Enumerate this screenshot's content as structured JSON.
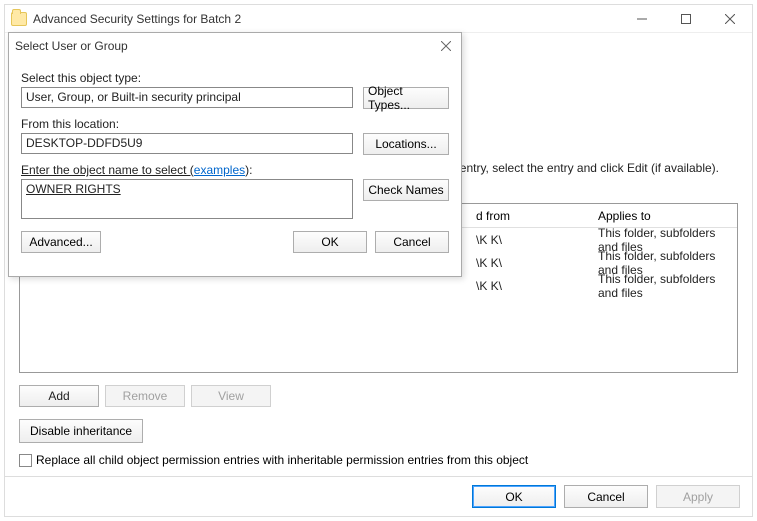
{
  "main": {
    "title": "Advanced Security Settings for Batch 2",
    "info_text": "entry, select the entry and click Edit (if available).",
    "perm_headers": {
      "inherited_from": "d from",
      "applies_to": "Applies to"
    },
    "perm_rows": [
      {
        "inherited_from": "\\K K\\",
        "applies_to": "This folder, subfolders and files"
      },
      {
        "inherited_from": "\\K K\\",
        "applies_to": "This folder, subfolders and files"
      },
      {
        "inherited_from": "\\K K\\",
        "applies_to": "This folder, subfolders and files"
      }
    ],
    "buttons": {
      "add": "Add",
      "remove": "Remove",
      "view": "View"
    },
    "disable_inheritance": "Disable inheritance",
    "replace_label": "Replace all child object permission entries with inheritable permission entries from this object",
    "ok": "OK",
    "cancel": "Cancel",
    "apply": "Apply"
  },
  "dialog": {
    "title": "Select User or Group",
    "object_type_label": "Select this object type:",
    "object_type_value": "User, Group, or Built-in security principal",
    "object_types_btn": "Object Types...",
    "location_label": "From this location:",
    "location_value": "DESKTOP-DDFD5U9",
    "locations_btn": "Locations...",
    "enter_label_prefix": "Enter the object name to select (",
    "enter_label_link": "examples",
    "enter_label_suffix": "):",
    "object_name_value": "OWNER RIGHTS",
    "check_names_btn": "Check Names",
    "advanced_btn": "Advanced...",
    "ok": "OK",
    "cancel": "Cancel"
  }
}
